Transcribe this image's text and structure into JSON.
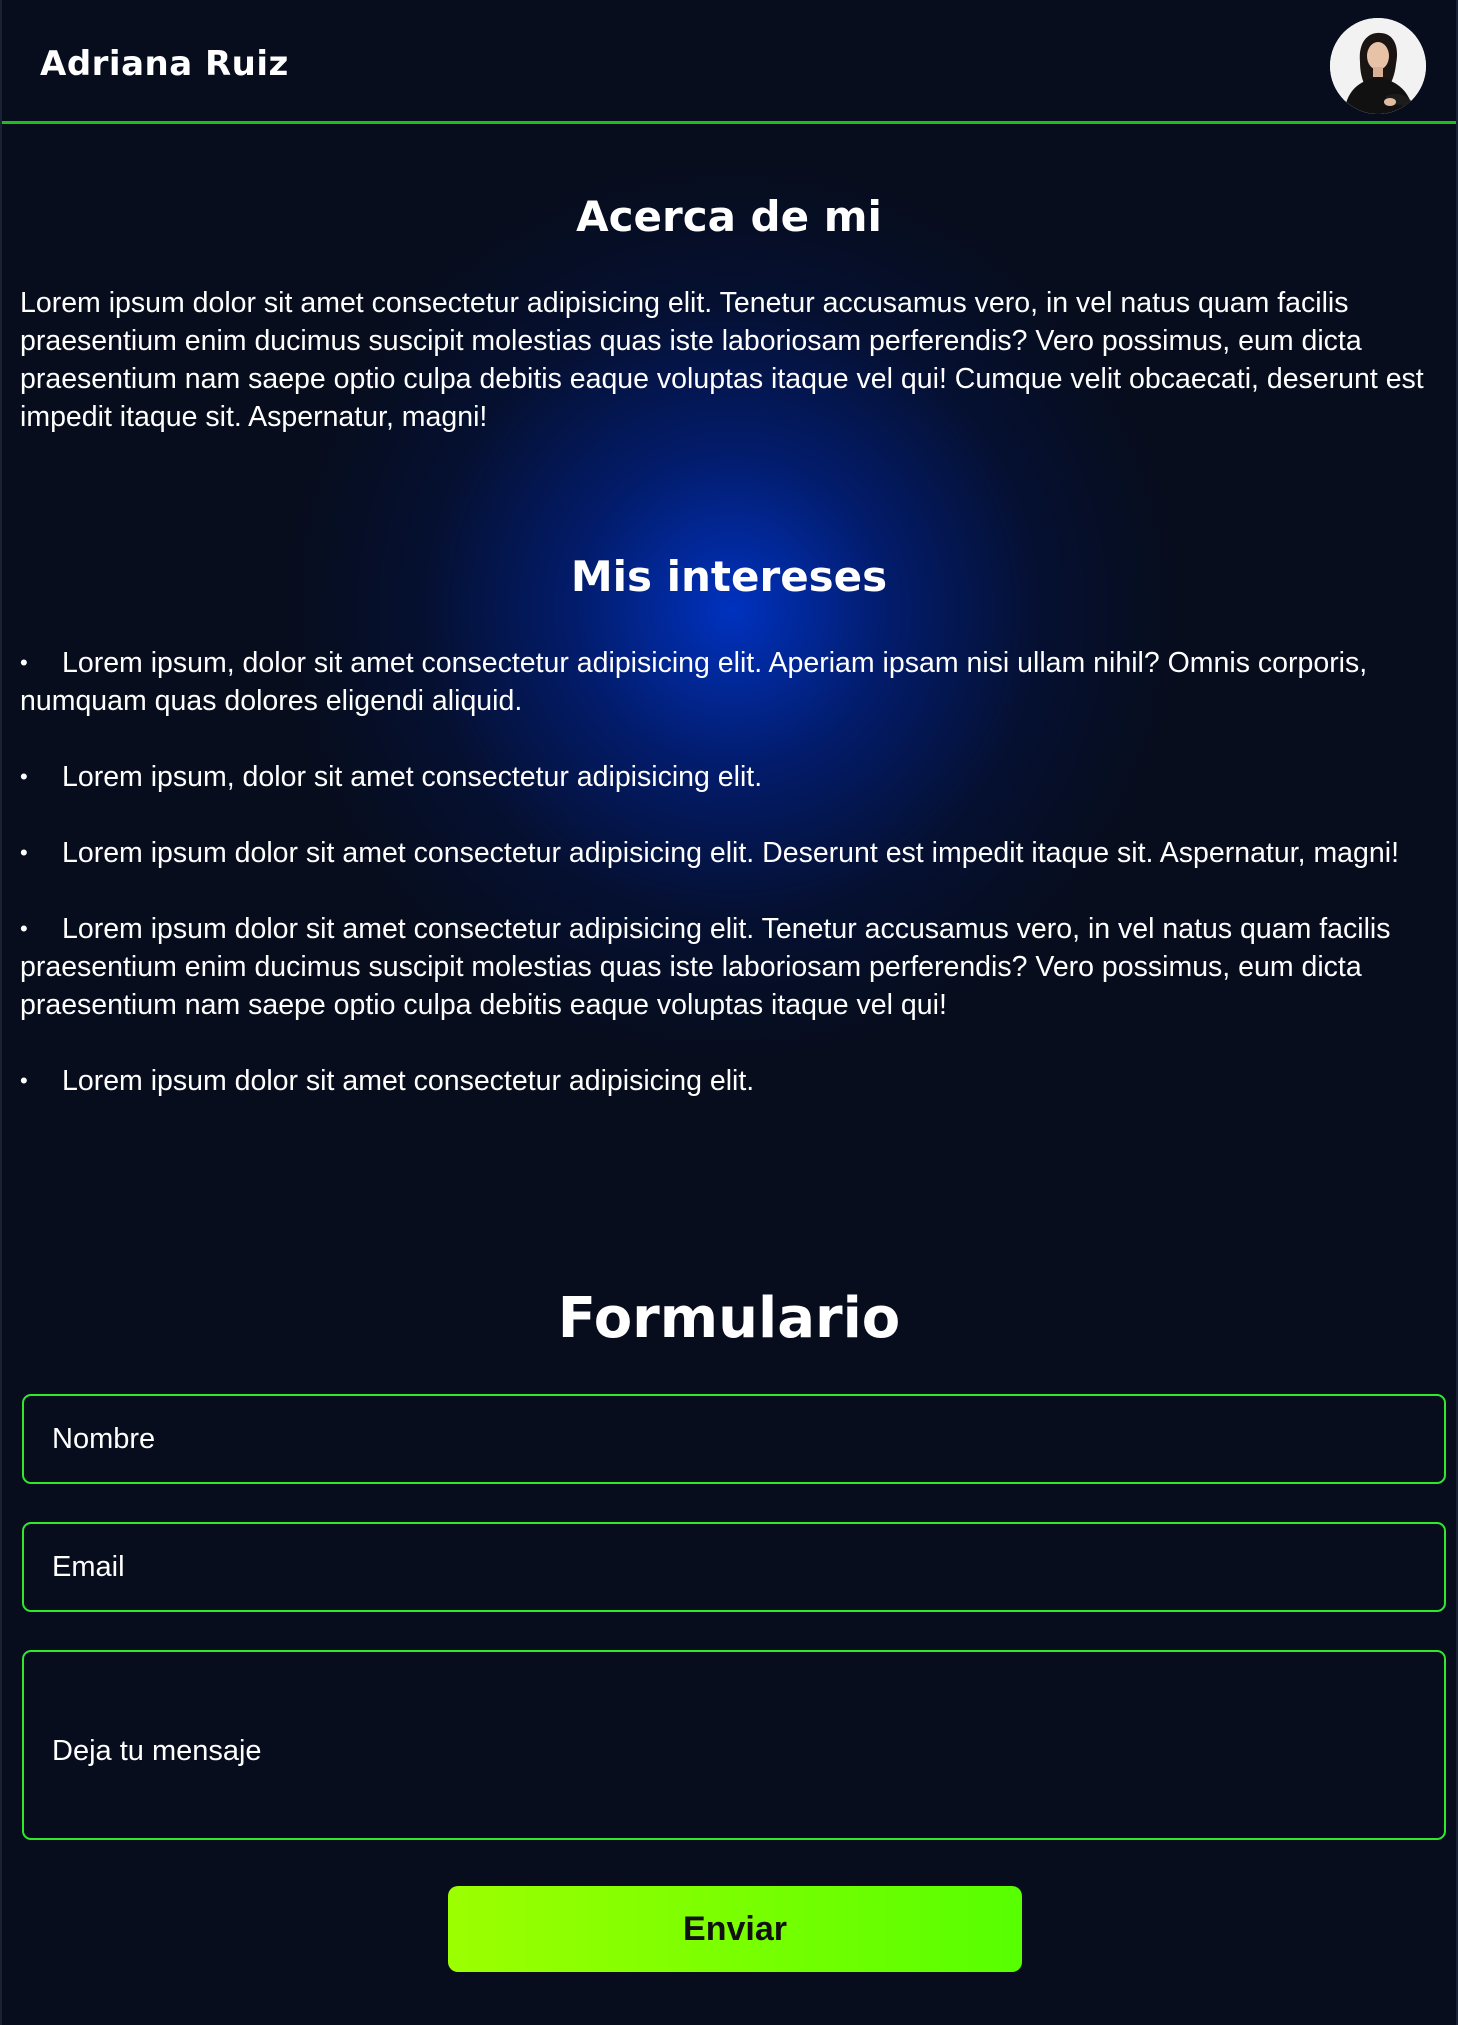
{
  "header": {
    "brand": "Adriana Ruiz",
    "avatar_icon": "profile-photo"
  },
  "about": {
    "title": "Acerca de mi",
    "text": "Lorem ipsum dolor sit amet consectetur adipisicing elit. Tenetur accusamus vero, in vel natus quam facilis praesentium enim ducimus suscipit molestias quas iste laboriosam perferendis? Vero possimus, eum dicta praesentium nam saepe optio culpa debitis eaque voluptas itaque vel qui! Cumque velit obcaecati, deserunt est impedit itaque sit. Aspernatur, magni!"
  },
  "interests": {
    "title": "Mis intereses",
    "items": [
      "Lorem ipsum, dolor sit amet consectetur adipisicing elit. Aperiam ipsam nisi ullam nihil? Omnis corporis, numquam quas dolores eligendi aliquid.",
      "Lorem ipsum, dolor sit amet consectetur adipisicing elit.",
      "Lorem ipsum dolor sit amet consectetur adipisicing elit. Deserunt est impedit itaque sit. Aspernatur, magni!",
      "Lorem ipsum dolor sit amet consectetur adipisicing elit. Tenetur accusamus vero, in vel natus quam facilis praesentium enim ducimus suscipit molestias quas iste laboriosam perferendis? Vero possimus, eum dicta praesentium nam saepe optio culpa debitis eaque voluptas itaque vel qui!",
      "Lorem ipsum dolor sit amet consectetur adipisicing elit."
    ]
  },
  "form": {
    "title": "Formulario",
    "name_placeholder": "Nombre",
    "email_placeholder": "Email",
    "message_placeholder": "Deja tu mensaje",
    "submit_label": "Enviar"
  },
  "colors": {
    "background": "#070d1d",
    "glow": "#0034c8",
    "accent_green": "#2ee82e",
    "button_gradient_start": "#9cff00",
    "button_gradient_end": "#57ff00"
  }
}
